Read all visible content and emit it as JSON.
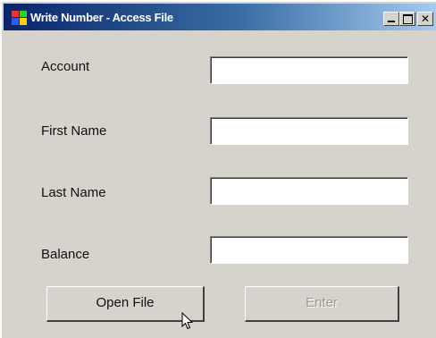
{
  "window": {
    "title": "Write Number - Access File"
  },
  "titlebar_buttons": {
    "minimize_icon": "minimize-icon",
    "maximize_icon": "maximize-icon",
    "close_glyph": "✕"
  },
  "form": {
    "fields": [
      {
        "label": "Account",
        "value": ""
      },
      {
        "label": "First Name",
        "value": ""
      },
      {
        "label": "Last Name",
        "value": ""
      },
      {
        "label": "Balance",
        "value": ""
      }
    ]
  },
  "buttons": {
    "open_file": "Open File",
    "enter": "Enter"
  },
  "colors": {
    "titlebar_start": "#0a246a",
    "titlebar_end": "#a6caf0",
    "window_bg": "#d6d3cc",
    "disabled_text": "#9c9a94"
  },
  "cursor": {
    "icon": "mouse-pointer-icon"
  }
}
